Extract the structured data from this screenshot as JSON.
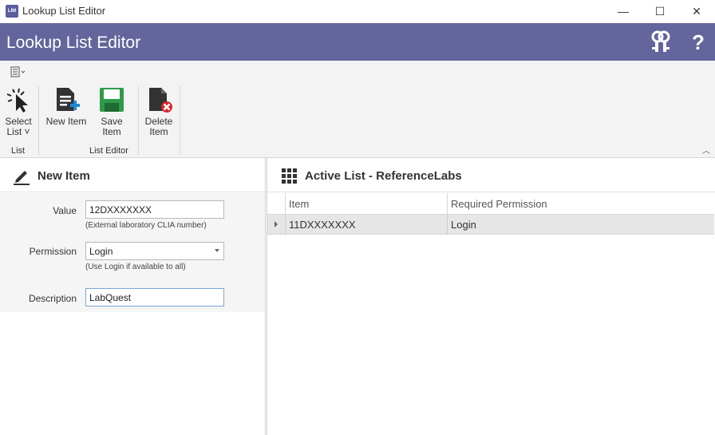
{
  "window": {
    "title": "Lookup List Editor",
    "icon_text": "LIM",
    "minimize": "—",
    "maximize": "☐",
    "close": "✕"
  },
  "header": {
    "title": "Lookup List Editor",
    "help": "?"
  },
  "ribbon": {
    "select_list": "Select List",
    "new_item": "New Item",
    "save_item": "Save Item",
    "delete_item": "Delete Item",
    "group_list": "List",
    "group_editor": "List Editor"
  },
  "left_panel": {
    "title": "New Item",
    "value_label": "Value",
    "value": "12DXXXXXXX",
    "value_hint": "(External laboratory CLIA number)",
    "permission_label": "Permission",
    "permission": "Login",
    "permission_hint": "(Use Login if available to all)",
    "description_label": "Description",
    "description": "LabQuest"
  },
  "right_panel": {
    "title": "Active List - ReferenceLabs",
    "columns": [
      "Item",
      "Required Permission"
    ],
    "rows": [
      {
        "item": "11DXXXXXXX",
        "permission": "Login"
      }
    ]
  },
  "colors": {
    "header_bg": "#63659c",
    "ribbon_bg": "#f3f3f3",
    "save_green": "#2e9a4a",
    "new_blue": "#1e88d0",
    "delete_red": "#d9262c"
  }
}
